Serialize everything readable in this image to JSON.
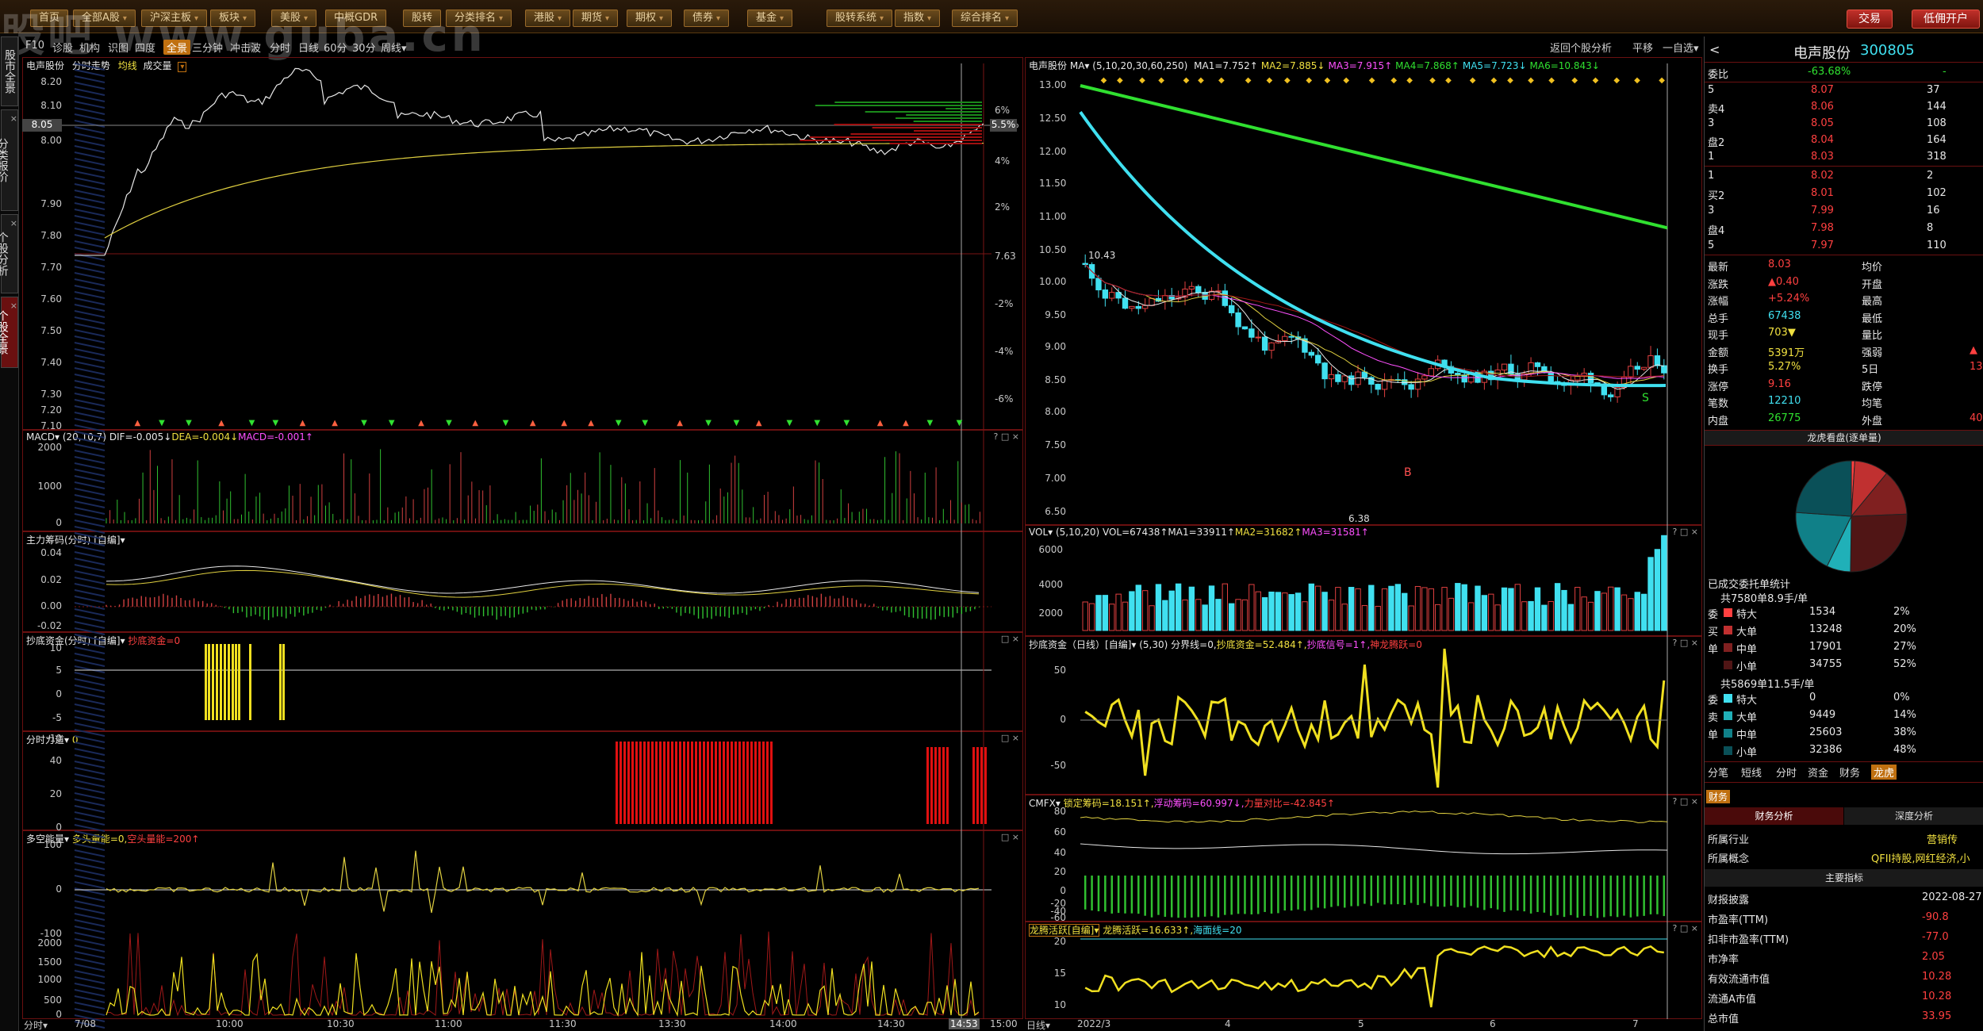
{
  "app": {
    "watermark": "股吧 www.guba.cn",
    "top_buttons": [
      {
        "label": "首页",
        "dd": false
      },
      {
        "label": "全部A股",
        "dd": true
      },
      {
        "label": "沪深主板",
        "dd": true
      },
      {
        "label": "板块",
        "dd": true
      },
      {
        "label": "美股",
        "dd": true
      },
      {
        "label": "中概GDR",
        "dd": false
      },
      {
        "label": "股转",
        "dd": false
      },
      {
        "label": "分类排名",
        "dd": true
      },
      {
        "label": "港股",
        "dd": true
      },
      {
        "label": "期货",
        "dd": true
      },
      {
        "label": "期权",
        "dd": true
      },
      {
        "label": "债券",
        "dd": true
      },
      {
        "label": "基金",
        "dd": true
      },
      {
        "label": "股转系统",
        "dd": true
      },
      {
        "label": "指数",
        "dd": true
      },
      {
        "label": "综合排名",
        "dd": true
      }
    ],
    "trade_button": "交易",
    "open_account_button": "低佣开户"
  },
  "side_tabs": [
    {
      "label": "股市全景",
      "active": false
    },
    {
      "label": "分类报价",
      "active": false
    },
    {
      "label": "个股分析",
      "active": false
    },
    {
      "label": "个股全景",
      "active": true
    }
  ],
  "left_toolbar": {
    "tabs": [
      "F10",
      "诊股",
      "机构",
      "识图",
      "四度",
      "全景",
      "三分钟",
      "冲击波",
      "分时",
      "日线",
      "60分",
      "30分",
      "周线▾"
    ],
    "selected": "全景",
    "right_items": [
      "返回个股分析",
      "平移",
      "一自选▾"
    ]
  },
  "intraday": {
    "title": "电声股份",
    "subtitle": "分时走势",
    "legend": [
      "均线",
      "成交量"
    ],
    "price_ticks": [
      "8.20",
      "8.10",
      "8.05",
      "8.00",
      "7.90",
      "7.80",
      "7.70",
      "7.60",
      "7.50",
      "7.40",
      "7.30",
      "7.20",
      "7.10"
    ],
    "pct_ticks": [
      "6%",
      "5.5%",
      "4%",
      "2%",
      "7.63",
      "-2%",
      "-4%",
      "-6%"
    ],
    "volume_ticks": [
      "2000",
      "1000",
      "0"
    ],
    "x_ticks": [
      "7/08",
      "10:00",
      "10:30",
      "11:00",
      "11:30",
      "13:30",
      "14:00",
      "14:30",
      "14:53",
      "15:00"
    ],
    "x_left_label": "分时▾"
  },
  "macd_panel": {
    "title": "MACD▾",
    "params": "(20,10,7)",
    "dif": "DIF=-0.005↓",
    "dea": "DEA=-0.004↓",
    "macd": "MACD=-0.001↑",
    "ticks": [
      "0.04",
      "0.02",
      "0.00",
      "-0.02"
    ]
  },
  "chip_panel": {
    "title": "主力筹码(分时)",
    "tag": "[自编]▾",
    "ticks": [
      "10",
      "5",
      "0",
      "-5",
      "-10"
    ]
  },
  "bottom_panel": {
    "title": "抄底资金(分时)",
    "tag": "[自编]▾",
    "value": "抄底资金=0",
    "ticks": [
      "40",
      "20",
      "0"
    ]
  },
  "force_panel": {
    "title": "分时力道▾",
    "value": "0",
    "ticks": [
      "100",
      "0",
      "-100"
    ]
  },
  "energy_panel": {
    "title": "多空能量▾",
    "value1": "多头量能=0,",
    "value2": "空头量能=200↑",
    "ticks": [
      "2000",
      "1500",
      "1000",
      "500",
      "0"
    ]
  },
  "daily": {
    "title": "电声股份",
    "ma_label": "MA▾",
    "ma_params": "(5,10,20,30,60,250)",
    "ma_values": [
      {
        "text": "MA1=7.752↑",
        "color": "#e8e8e8"
      },
      {
        "text": "MA2=7.885↓",
        "color": "#f0e040"
      },
      {
        "text": "MA3=7.915↑",
        "color": "#ff50ff"
      },
      {
        "text": "MA4=7.868↑",
        "color": "#30e030"
      },
      {
        "text": "MA5=7.723↓",
        "color": "#40e0f0"
      },
      {
        "text": "MA6=10.843↓",
        "color": "#30e030"
      }
    ],
    "price_ticks": [
      "13.00",
      "12.50",
      "12.00",
      "11.50",
      "11.00",
      "10.50",
      "10.00",
      "9.50",
      "9.00",
      "8.50",
      "8.00",
      "7.50",
      "7.00",
      "6.50"
    ],
    "high_label": "10.43",
    "low_label": "6.38",
    "buy_mark": "B",
    "sell_mark": "S",
    "x_ticks": [
      "2022/3",
      "4",
      "5",
      "6",
      "7"
    ],
    "x_left_label": "日线▾"
  },
  "vol_panel": {
    "title": "VOL▾",
    "params": "(5,10,20)",
    "vol": "VOL=67438↑",
    "ma1": "MA1=33911↑",
    "ma2": "MA2=31682↑",
    "ma3": "MA3=31581↑",
    "ticks": [
      "6000",
      "4000",
      "2000"
    ]
  },
  "daily_bottom_panel": {
    "title": "抄底资金（日线）",
    "tag": "[自编]▾",
    "params": "(5,30)",
    "v1": "分界线=0,",
    "v2": "抄底资金=52.484↑,",
    "v3": "抄底信号=1↑,",
    "v4": "神龙腾跃=0",
    "ticks": [
      "50",
      "0",
      "-50"
    ]
  },
  "cmfx_panel": {
    "title": "CMFX▾",
    "v1": "锁定筹码=18.151↑,",
    "v2": "浮动筹码=60.997↓,",
    "v3": "力量对比=-42.845↑",
    "ticks": [
      "80",
      "60",
      "40",
      "20",
      "0",
      "-20",
      "-40",
      "-60"
    ]
  },
  "dragon_panel": {
    "title": "龙腾活跃[自编]▾",
    "v1": "龙腾活跃=16.633↑,",
    "v2": "海面线=20",
    "ticks": [
      "20",
      "15",
      "10"
    ]
  },
  "quote": {
    "name": "电声股份",
    "code": "300805",
    "webi_label": "委比",
    "webi_value": "-63.68%",
    "webi_right": "-",
    "asks": [
      {
        "label": "5",
        "price": "8.07",
        "vol": "37"
      },
      {
        "label": "卖4",
        "price": "8.06",
        "vol": "144"
      },
      {
        "label": "3",
        "price": "8.05",
        "vol": "108"
      },
      {
        "label": "盘2",
        "price": "8.04",
        "vol": "164"
      },
      {
        "label": "1",
        "price": "8.03",
        "vol": "318"
      }
    ],
    "bids": [
      {
        "label": "1",
        "price": "8.02",
        "vol": "2"
      },
      {
        "label": "买2",
        "price": "8.01",
        "vol": "102"
      },
      {
        "label": "3",
        "price": "7.99",
        "vol": "16"
      },
      {
        "label": "盘4",
        "price": "7.98",
        "vol": "8"
      },
      {
        "label": "5",
        "price": "7.97",
        "vol": "110"
      }
    ],
    "stats": [
      {
        "l": "最新",
        "v": "8.03",
        "vc": "red",
        "r": "均价",
        "rv": ""
      },
      {
        "l": "涨跌",
        "v": "▲0.40",
        "vc": "red",
        "r": "开盘",
        "rv": ""
      },
      {
        "l": "涨幅",
        "v": "+5.24%",
        "vc": "red",
        "r": "最高",
        "rv": ""
      },
      {
        "l": "总手",
        "v": "67438",
        "vc": "cyan",
        "r": "最低",
        "rv": ""
      },
      {
        "l": "现手",
        "v": "703▼",
        "vc": "yel",
        "r": "量比",
        "rv": ""
      },
      {
        "l": "金额",
        "v": "5391万",
        "vc": "yel",
        "r": "强弱",
        "rv": "▲"
      },
      {
        "l": "换手",
        "v": "5.27%",
        "vc": "yel",
        "r": "5日",
        "rv": "13."
      },
      {
        "l": "涨停",
        "v": "9.16",
        "vc": "red",
        "r": "跌停",
        "rv": ""
      },
      {
        "l": "笔数",
        "v": "12210",
        "vc": "cyan",
        "r": "均笔",
        "rv": ""
      },
      {
        "l": "内盘",
        "v": "26775",
        "vc": "grn",
        "r": "外盘",
        "rv": "40"
      }
    ],
    "lhb_title": "龙虎看盘(逐单量)",
    "orders_title": "已成交委托单统计",
    "buy_summary": "共7580单8.9手/单",
    "buy_rows": [
      {
        "side": "委",
        "label": "特大",
        "vol": "1534",
        "pct": "2%",
        "color": "#ff4040"
      },
      {
        "side": "买",
        "label": "大单",
        "vol": "13248",
        "pct": "20%",
        "color": "#c03030"
      },
      {
        "side": "单",
        "label": "中单",
        "vol": "17901",
        "pct": "27%",
        "color": "#802020"
      },
      {
        "side": "",
        "label": "小单",
        "vol": "34755",
        "pct": "52%",
        "color": "#501515"
      }
    ],
    "sell_summary": "共5869单11.5手/单",
    "sell_rows": [
      {
        "side": "委",
        "label": "特大",
        "vol": "0",
        "pct": "0%",
        "color": "#40e0f0"
      },
      {
        "side": "卖",
        "label": "大单",
        "vol": "9449",
        "pct": "14%",
        "color": "#20b0b8"
      },
      {
        "side": "单",
        "label": "中单",
        "vol": "25603",
        "pct": "38%",
        "color": "#108088"
      },
      {
        "side": "",
        "label": "小单",
        "vol": "32386",
        "pct": "48%",
        "color": "#0a5058"
      }
    ],
    "tabs": [
      "分笔",
      "短线",
      "分时",
      "资金",
      "财务",
      "龙虎"
    ],
    "tab_selected": "龙虎",
    "fin_tab": "财务",
    "fin_buttons": [
      "财务分析",
      "深度分析"
    ],
    "industry_label": "所属行业",
    "industry_value": "营销传",
    "concept_label": "所属概念",
    "concept_value": "QFII持股,网红经济,小",
    "indicator_title": "主要指标",
    "fin_rows": [
      {
        "l": "财报披露",
        "v": "2022-08-27"
      },
      {
        "l": "市盈率(TTM)",
        "v": "-90.8"
      },
      {
        "l": "扣非市盈率(TTM)",
        "v": "-77.0"
      },
      {
        "l": "市净率",
        "v": "2.05"
      },
      {
        "l": "有效流通市值",
        "v": "10.28"
      },
      {
        "l": "流通A市值",
        "v": "10.28"
      },
      {
        "l": "总市值",
        "v": "33.95"
      }
    ]
  },
  "pie_data": {
    "slices": [
      2,
      20,
      27,
      52,
      0,
      14,
      38,
      48
    ],
    "colors": [
      "#ff4040",
      "#c03030",
      "#802020",
      "#501515",
      "#40e0f0",
      "#20b0b8",
      "#108088",
      "#0a5058"
    ]
  }
}
